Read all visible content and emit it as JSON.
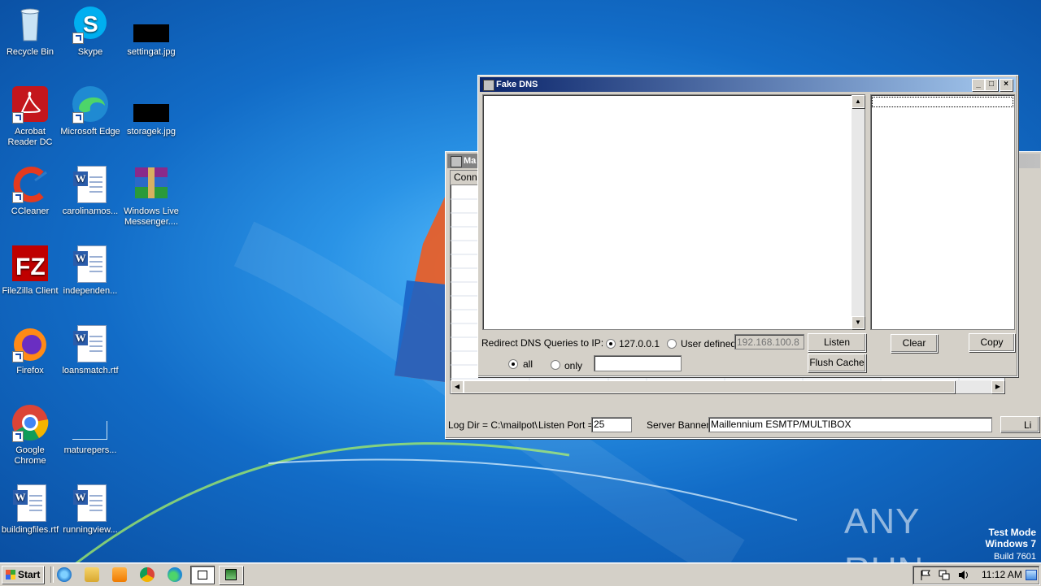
{
  "desktop": {
    "icons": [
      {
        "label": "Recycle Bin"
      },
      {
        "label": "Skype"
      },
      {
        "label": "settingat.jpg"
      },
      {
        "label": "Acrobat Reader DC"
      },
      {
        "label": "Microsoft Edge"
      },
      {
        "label": "storagek.jpg"
      },
      {
        "label": "CCleaner"
      },
      {
        "label": "carolinamos..."
      },
      {
        "label": "Windows Live Messenger...."
      },
      {
        "label": "FileZilla Client"
      },
      {
        "label": "independen..."
      },
      {
        "label": "Firefox"
      },
      {
        "label": "loansmatch.rtf"
      },
      {
        "label": "Google Chrome"
      },
      {
        "label": "maturepers..."
      },
      {
        "label": "buildingfiles.rtf"
      },
      {
        "label": "runningview..."
      }
    ],
    "watermark": {
      "brand": "ANY RUN",
      "mode": "Test Mode",
      "os": "Windows 7",
      "build": "Build 7601"
    }
  },
  "mail_window": {
    "title": "Ma",
    "column_header": "Conn",
    "log_dir": "Log Dir = C:\\mailpot\\",
    "listen_port_label": "Listen Port =",
    "listen_port_value": "25",
    "server_banner_label": "Server Banner",
    "server_banner_value": "Maillennium ESMTP/MULTIBOX",
    "listen_button": "Li"
  },
  "dns_window": {
    "title": "Fake DNS",
    "redirect_label": "Redirect DNS Queries to IP:",
    "radio_localhost": "127.0.0.1",
    "radio_user_defined": "User defined",
    "user_ip_placeholder": "192.168.100.8",
    "listen_button": "Listen",
    "flush_button": "Flush Cache",
    "radio_all": "all",
    "radio_only": "only",
    "clear_button": "Clear",
    "copy_button": "Copy",
    "title_buttons": {
      "minimize": "_",
      "maximize": "□",
      "close": "×"
    }
  },
  "taskbar": {
    "start_label": "Start",
    "clock": "11:12 AM"
  }
}
